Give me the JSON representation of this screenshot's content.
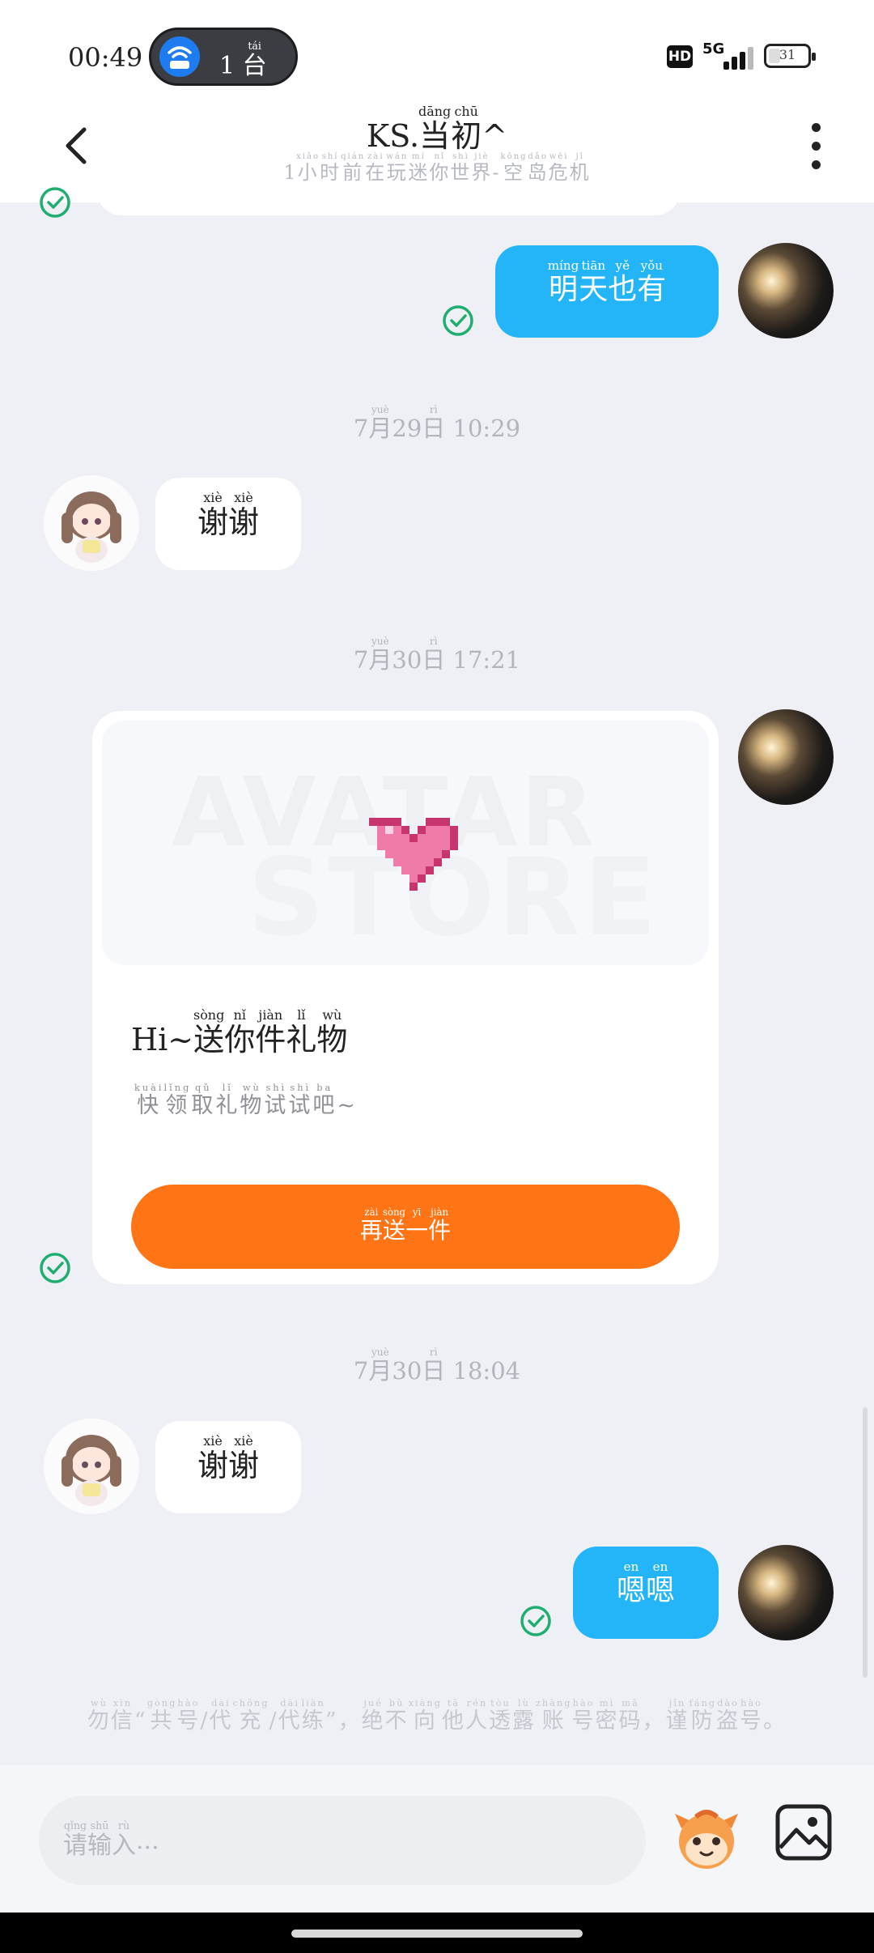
{
  "status_bar": {
    "time": "00:49",
    "connected_devices": "1",
    "device_unit": {
      "char": "台",
      "pinyin": "tái"
    },
    "hd": "HD",
    "network": "5G",
    "battery": "31",
    "battery_level": 0.31
  },
  "header": {
    "title_prefix": "KS.",
    "title_chars": [
      {
        "char": "当",
        "pinyin": "dāng"
      },
      {
        "char": "初",
        "pinyin": "chū"
      }
    ],
    "title_suffix": "^",
    "subtitle_prefix": "1",
    "subtitle_chars": [
      {
        "char": "小",
        "pinyin": "xiǎo"
      },
      {
        "char": "时",
        "pinyin": "shí"
      },
      {
        "char": "前",
        "pinyin": "qián"
      },
      {
        "char": "在",
        "pinyin": "zài"
      },
      {
        "char": "玩",
        "pinyin": "wán"
      },
      {
        "char": "迷",
        "pinyin": "mí"
      },
      {
        "char": "你",
        "pinyin": "nǐ"
      },
      {
        "char": "世",
        "pinyin": "shì"
      },
      {
        "char": "界",
        "pinyin": "jiè"
      },
      {
        "char": "-",
        "pinyin": ""
      },
      {
        "char": "空",
        "pinyin": "kōng"
      },
      {
        "char": "岛",
        "pinyin": "dǎo"
      },
      {
        "char": "危",
        "pinyin": "wēi"
      },
      {
        "char": "机",
        "pinyin": "jī"
      }
    ]
  },
  "messages": {
    "msg1": [
      {
        "char": "明",
        "pinyin": "míng"
      },
      {
        "char": "天",
        "pinyin": "tiān"
      },
      {
        "char": "也",
        "pinyin": "yě"
      },
      {
        "char": "有",
        "pinyin": "yǒu"
      }
    ],
    "ts1": {
      "month": "7",
      "day": "29",
      "time": "10:29"
    },
    "msg2": [
      {
        "char": "谢",
        "pinyin": "xiè"
      },
      {
        "char": "谢",
        "pinyin": "xiè"
      }
    ],
    "ts2": {
      "month": "7",
      "day": "30",
      "time": "17:21"
    },
    "ts3": {
      "month": "7",
      "day": "30",
      "time": "18:04"
    },
    "msg3": [
      {
        "char": "谢",
        "pinyin": "xiè"
      },
      {
        "char": "谢",
        "pinyin": "xiè"
      }
    ],
    "msg4": [
      {
        "char": "嗯",
        "pinyin": "en"
      },
      {
        "char": "嗯",
        "pinyin": "en"
      }
    ],
    "month_char": {
      "char": "月",
      "pinyin": "yuè"
    },
    "day_char": {
      "char": "日",
      "pinyin": "rì"
    }
  },
  "gift_card": {
    "watermark_line1": "AVATAR",
    "watermark_line2": "STORE",
    "title_prefix": "Hi~",
    "title_chars": [
      {
        "char": "送",
        "pinyin": "sòng"
      },
      {
        "char": "你",
        "pinyin": "nǐ"
      },
      {
        "char": "件",
        "pinyin": "jiàn"
      },
      {
        "char": "礼",
        "pinyin": "lǐ"
      },
      {
        "char": "物",
        "pinyin": "wù"
      }
    ],
    "subtitle_chars": [
      {
        "char": "快",
        "pinyin": "kuài"
      },
      {
        "char": "领",
        "pinyin": "lǐng"
      },
      {
        "char": "取",
        "pinyin": "qǔ"
      },
      {
        "char": "礼",
        "pinyin": "lǐ"
      },
      {
        "char": "物",
        "pinyin": "wù"
      },
      {
        "char": "试",
        "pinyin": "shì"
      },
      {
        "char": "试",
        "pinyin": "shì"
      },
      {
        "char": "吧",
        "pinyin": "ba"
      },
      {
        "char": "~",
        "pinyin": ""
      }
    ],
    "button_chars": [
      {
        "char": "再",
        "pinyin": "zài"
      },
      {
        "char": "送",
        "pinyin": "sòng"
      },
      {
        "char": "一",
        "pinyin": "yī"
      },
      {
        "char": "件",
        "pinyin": "jiàn"
      }
    ]
  },
  "notice": [
    {
      "char": "勿",
      "pinyin": "wù"
    },
    {
      "char": "信",
      "pinyin": "xìn"
    },
    {
      "char": "“",
      "pinyin": ""
    },
    {
      "char": "共",
      "pinyin": "gòng"
    },
    {
      "char": "号",
      "pinyin": "hào"
    },
    {
      "char": "/",
      "pinyin": ""
    },
    {
      "char": "代",
      "pinyin": "dài"
    },
    {
      "char": "充",
      "pinyin": "chōng"
    },
    {
      "char": "/",
      "pinyin": ""
    },
    {
      "char": "代",
      "pinyin": "dài"
    },
    {
      "char": "练",
      "pinyin": "liàn"
    },
    {
      "char": "”",
      "pinyin": ""
    },
    {
      "char": "，",
      "pinyin": ""
    },
    {
      "char": "绝",
      "pinyin": "jué"
    },
    {
      "char": "不",
      "pinyin": "bù"
    },
    {
      "char": "向",
      "pinyin": "xiàng"
    },
    {
      "char": "他",
      "pinyin": "tā"
    },
    {
      "char": "人",
      "pinyin": "rén"
    },
    {
      "char": "透",
      "pinyin": "tòu"
    },
    {
      "char": "露",
      "pinyin": "lù"
    },
    {
      "char": "账",
      "pinyin": "zhàng"
    },
    {
      "char": "号",
      "pinyin": "hào"
    },
    {
      "char": "密",
      "pinyin": "mì"
    },
    {
      "char": "码",
      "pinyin": "mǎ"
    },
    {
      "char": "，",
      "pinyin": ""
    },
    {
      "char": "谨",
      "pinyin": "jǐn"
    },
    {
      "char": "防",
      "pinyin": "fáng"
    },
    {
      "char": "盗",
      "pinyin": "dào"
    },
    {
      "char": "号",
      "pinyin": "hào"
    },
    {
      "char": "。",
      "pinyin": ""
    }
  ],
  "input": {
    "placeholder_chars": [
      {
        "char": "请",
        "pinyin": "qǐng"
      },
      {
        "char": "输",
        "pinyin": "shū"
      },
      {
        "char": "入",
        "pinyin": "rù"
      }
    ],
    "placeholder_suffix": "..."
  },
  "icons": {
    "back": "back-arrow-icon",
    "more": "more-vertical-icon",
    "check": "check-circle-icon",
    "emoji": "emoji-sticker-icon",
    "image": "image-gallery-icon",
    "accent_blue": "#23b5f7",
    "accent_orange": "#ff7414",
    "check_green": "#1fae6f"
  }
}
